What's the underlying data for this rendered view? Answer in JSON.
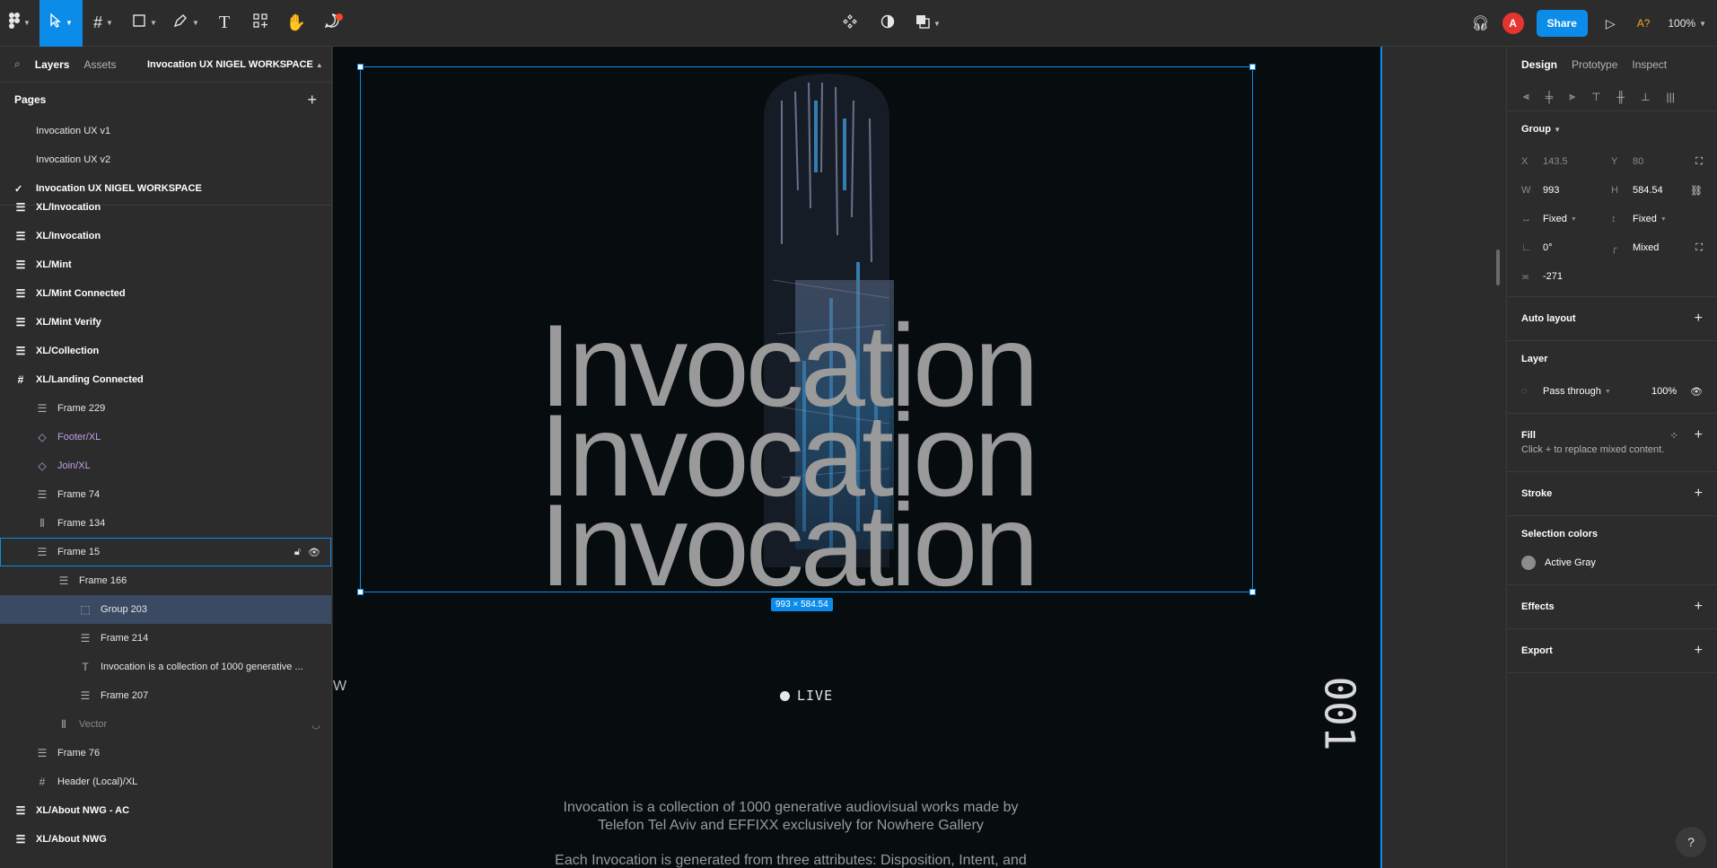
{
  "toolbar": {
    "zoom": "100%",
    "share_label": "Share",
    "avatar_letter": "A",
    "font_warning": "A?",
    "accent": "#0c8ce9"
  },
  "left_panel": {
    "tab_layers": "Layers",
    "tab_assets": "Assets",
    "page_name": "Invocation UX NIGEL WORKSPACE",
    "pages_title": "Pages",
    "pages": [
      {
        "label": "Invocation UX v1",
        "current": false
      },
      {
        "label": "Invocation UX v2",
        "current": false
      },
      {
        "label": "Invocation UX NIGEL WORKSPACE",
        "current": true
      }
    ],
    "layers": [
      {
        "label": "XL/Invocation",
        "icon": "frame-list-icon",
        "level": 0,
        "type": "top"
      },
      {
        "label": "XL/Invocation",
        "icon": "frame-list-icon",
        "level": 0,
        "type": "top"
      },
      {
        "label": "XL/Mint",
        "icon": "frame-list-icon",
        "level": 0,
        "type": "top"
      },
      {
        "label": "XL/Mint Connected",
        "icon": "frame-list-icon",
        "level": 0,
        "type": "top"
      },
      {
        "label": "XL/Mint Verify",
        "icon": "frame-list-icon",
        "level": 0,
        "type": "top"
      },
      {
        "label": "XL/Collection",
        "icon": "frame-list-icon",
        "level": 0,
        "type": "top"
      },
      {
        "label": "XL/Landing Connected",
        "icon": "frame-hash-icon",
        "level": 0,
        "type": "top"
      },
      {
        "label": "Frame 229",
        "icon": "frame-list-icon",
        "level": 1,
        "type": "normal"
      },
      {
        "label": "Footer/XL",
        "icon": "component-icon",
        "level": 1,
        "type": "comp"
      },
      {
        "label": "Join/XL",
        "icon": "component-icon",
        "level": 1,
        "type": "comp"
      },
      {
        "label": "Frame 74",
        "icon": "frame-list-icon",
        "level": 1,
        "type": "normal"
      },
      {
        "label": "Frame 134",
        "icon": "frame-columns-icon",
        "level": 1,
        "type": "normal"
      },
      {
        "label": "Frame 15",
        "icon": "frame-list-icon",
        "level": 1,
        "type": "hover"
      },
      {
        "label": "Frame 166",
        "icon": "frame-list-icon",
        "level": 2,
        "type": "normal"
      },
      {
        "label": "Group 203",
        "icon": "group-icon",
        "level": 3,
        "type": "selected"
      },
      {
        "label": "Frame 214",
        "icon": "frame-list-icon",
        "level": 3,
        "type": "normal"
      },
      {
        "label": "Invocation is a collection of 1000 generative ...",
        "icon": "text-icon",
        "level": 3,
        "type": "normal"
      },
      {
        "label": "Frame 207",
        "icon": "frame-list-icon",
        "level": 3,
        "type": "normal"
      },
      {
        "label": "Vector",
        "icon": "vector-icon",
        "level": 2,
        "type": "dim"
      },
      {
        "label": "Frame 76",
        "icon": "frame-list-icon",
        "level": 1,
        "type": "normal"
      },
      {
        "label": "Header (Local)/XL",
        "icon": "frame-hash-icon",
        "level": 1,
        "type": "normal"
      },
      {
        "label": "XL/About NWG - AC",
        "icon": "frame-list-icon",
        "level": 0,
        "type": "top"
      },
      {
        "label": "XL/About NWG",
        "icon": "frame-list-icon",
        "level": 0,
        "type": "top"
      }
    ]
  },
  "canvas": {
    "title_lines": [
      "Invocation",
      "Invocation",
      "Invocation"
    ],
    "selection_size": "993 × 584.54",
    "live_label": "LIVE",
    "vertical_number": "001",
    "edge_letter": "W",
    "desc_line1": "Invocation is a collection of 1000 generative audiovisual works made by Telefon Tel Aviv and EFFIXX exclusively for Nowhere Gallery",
    "desc_line2": "Each Invocation is generated from three attributes: Disposition, Intent, and"
  },
  "right_panel": {
    "tab_design": "Design",
    "tab_prototype": "Prototype",
    "tab_inspect": "Inspect",
    "group_label": "Group",
    "x_label": "X",
    "x_value": "143.5",
    "y_label": "Y",
    "y_value": "80",
    "w_label": "W",
    "w_value": "993",
    "h_label": "H",
    "h_value": "584.54",
    "width_mode": "Fixed",
    "height_mode": "Fixed",
    "rotation": "0°",
    "radius": "Mixed",
    "spacing": "-271",
    "auto_layout": "Auto layout",
    "layer_title": "Layer",
    "blend_mode": "Pass through",
    "opacity": "100%",
    "fill_title": "Fill",
    "fill_hint": "Click + to replace mixed content.",
    "stroke_title": "Stroke",
    "selection_colors_title": "Selection colors",
    "selection_color_name": "Active Gray",
    "selection_color_hex": "#8c8c8c",
    "effects_title": "Effects",
    "export_title": "Export"
  }
}
